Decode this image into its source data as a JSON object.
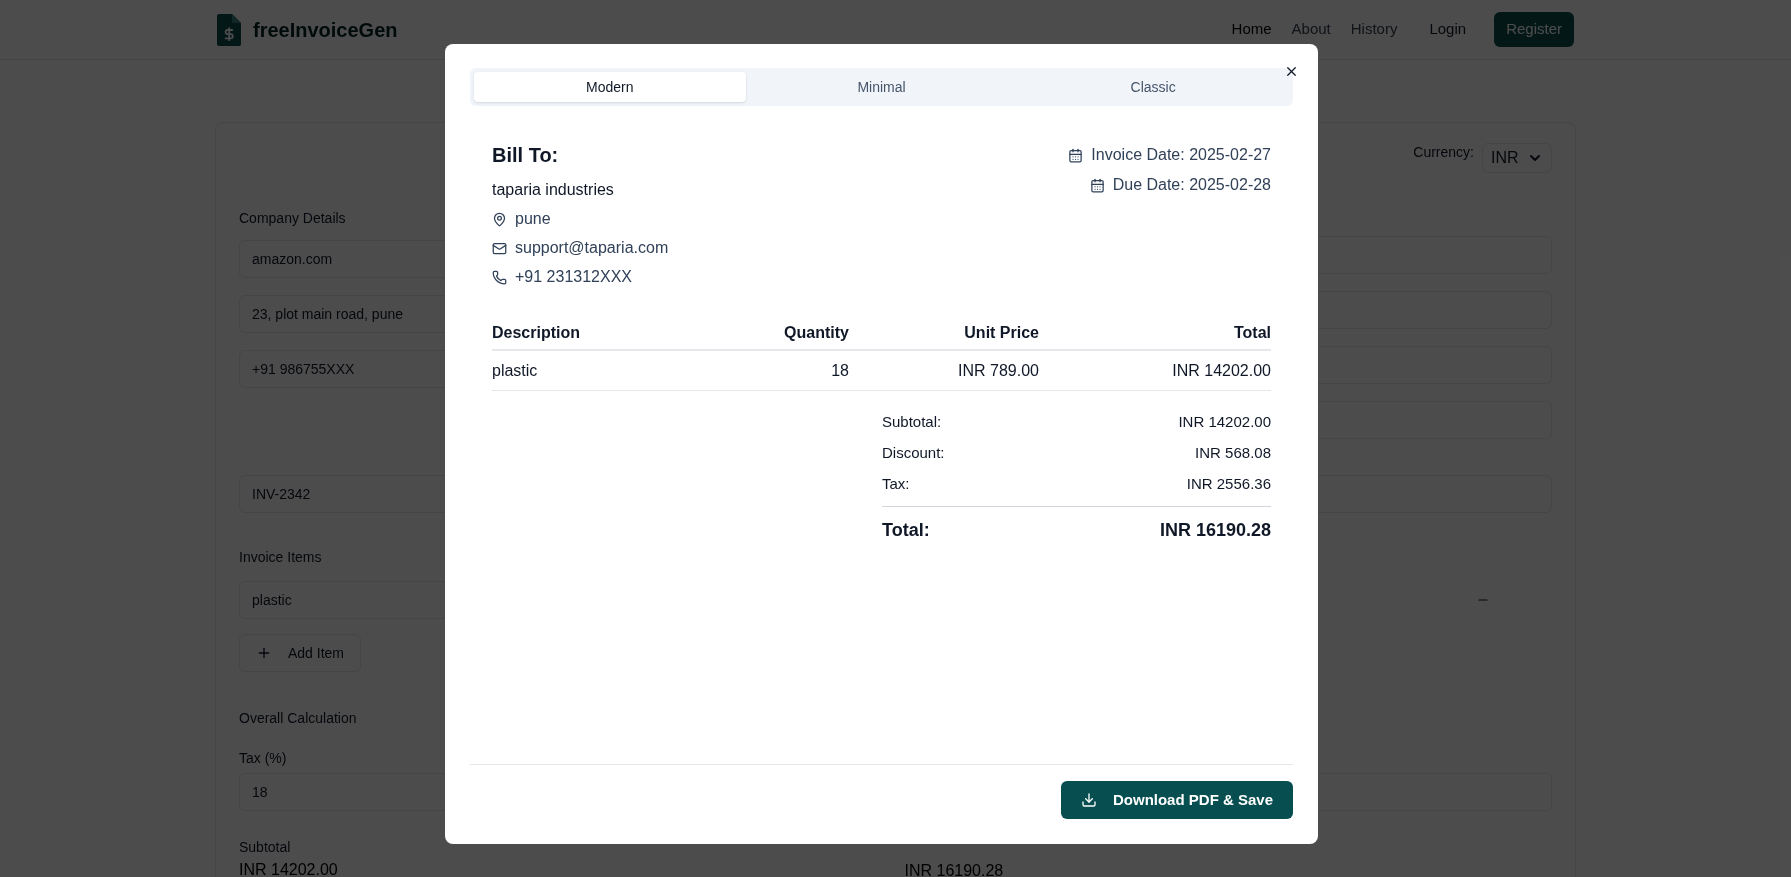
{
  "navbar": {
    "brand": "freeInvoiceGen",
    "links": [
      "Home",
      "About",
      "History"
    ],
    "login": "Login",
    "register": "Register"
  },
  "form": {
    "currency_label": "Currency:",
    "currency_value": "INR",
    "company_heading": "Company Details",
    "company_fields": [
      "amazon.com",
      "23, plot main road, pune",
      "+91 986755XXX"
    ],
    "invoice_number": "INV-2342",
    "items_heading": "Invoice Items",
    "items": [
      {
        "description": "plastic"
      }
    ],
    "add_item": "Add Item",
    "calc_heading": "Overall Calculation",
    "tax_label": "Tax (%)",
    "tax_value": "18",
    "subtotal_label": "Subtotal",
    "subtotal_value": "INR 14202.00",
    "total_value": "INR 16190.28"
  },
  "modal": {
    "tabs": [
      {
        "label": "Modern",
        "selected": true
      },
      {
        "label": "Minimal",
        "selected": false
      },
      {
        "label": "Classic",
        "selected": false
      }
    ],
    "bill_to": "Bill To:",
    "client_name": "taparia industries",
    "address": "pune",
    "email": "support@taparia.com",
    "phone": "+91 231312XXX",
    "invoice_date": "Invoice Date: 2025-02-27",
    "due_date": "Due Date: 2025-02-28",
    "table": {
      "columns": [
        "Description",
        "Quantity",
        "Unit Price",
        "Total"
      ],
      "rows": [
        [
          "plastic",
          "18",
          "INR 789.00",
          "INR 14202.00"
        ]
      ]
    },
    "summary": [
      {
        "label": "Subtotal:",
        "value": "INR 14202.00"
      },
      {
        "label": "Discount:",
        "value": "INR 568.08"
      },
      {
        "label": "Tax:",
        "value": "INR 2556.36"
      }
    ],
    "total_label": "Total:",
    "total_value": "INR 16190.28",
    "download": "Download PDF & Save"
  }
}
